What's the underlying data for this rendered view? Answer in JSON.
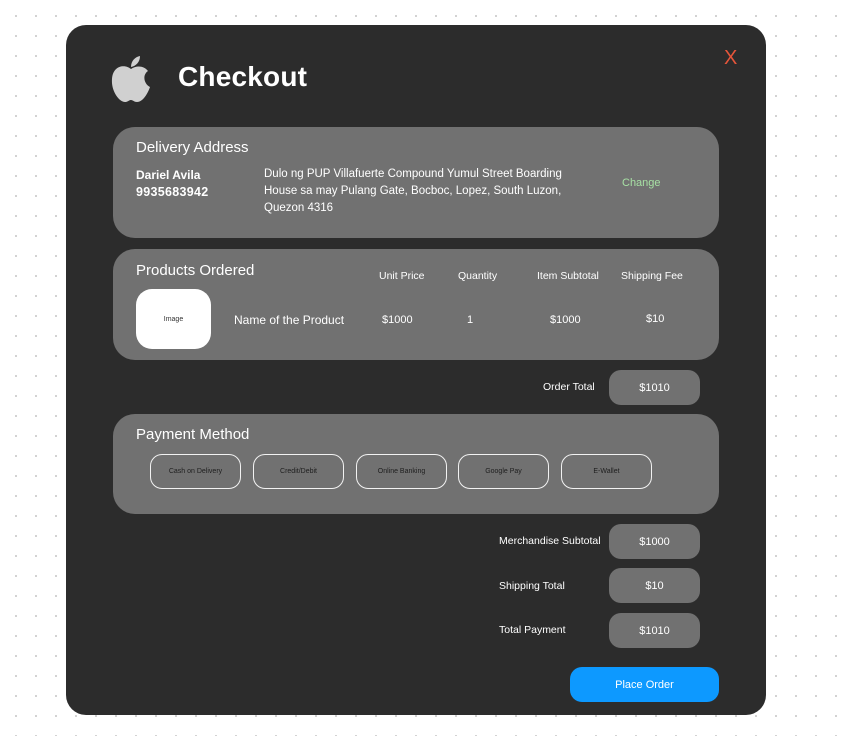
{
  "header": {
    "title": "Checkout",
    "close_label": "X"
  },
  "delivery": {
    "title": "Delivery Address",
    "name": "Dariel Avila",
    "phone": "9935683942",
    "address": "Dulo ng PUP Villafuerte Compound Yumul Street Boarding House sa may Pulang Gate, Bocboc, Lopez, South Luzon, Quezon 4316",
    "change_label": "Change"
  },
  "products": {
    "title": "Products Ordered",
    "columns": [
      "Unit Price",
      "Quantity",
      "Item Subtotal",
      "Shipping Fee"
    ],
    "items": [
      {
        "image_label": "Image",
        "name": "Name of the Product",
        "unit_price": "$1000",
        "quantity": "1",
        "subtotal": "$1000",
        "shipping_fee": "$10"
      }
    ]
  },
  "order_total": {
    "label": "Order Total",
    "value": "$1010"
  },
  "payment": {
    "title": "Payment Method",
    "methods": [
      "Cash on Delivery",
      "Credit/Debit",
      "Online Banking",
      "Google Pay",
      "E-Wallet"
    ]
  },
  "summary": {
    "merchandise_subtotal": {
      "label": "Merchandise Subtotal",
      "value": "$1000"
    },
    "shipping_total": {
      "label": "Shipping Total",
      "value": "$10"
    },
    "total_payment": {
      "label": "Total Payment",
      "value": "$1010"
    }
  },
  "place_order_label": "Place Order",
  "icons": {
    "logo": "apple-logo-icon",
    "close": "close-icon"
  },
  "colors": {
    "accent": "#0d99ff",
    "close": "#e5553a",
    "change": "#a7e0a4",
    "modal_bg": "#2c2c2c",
    "panel_bg": "#717171"
  }
}
